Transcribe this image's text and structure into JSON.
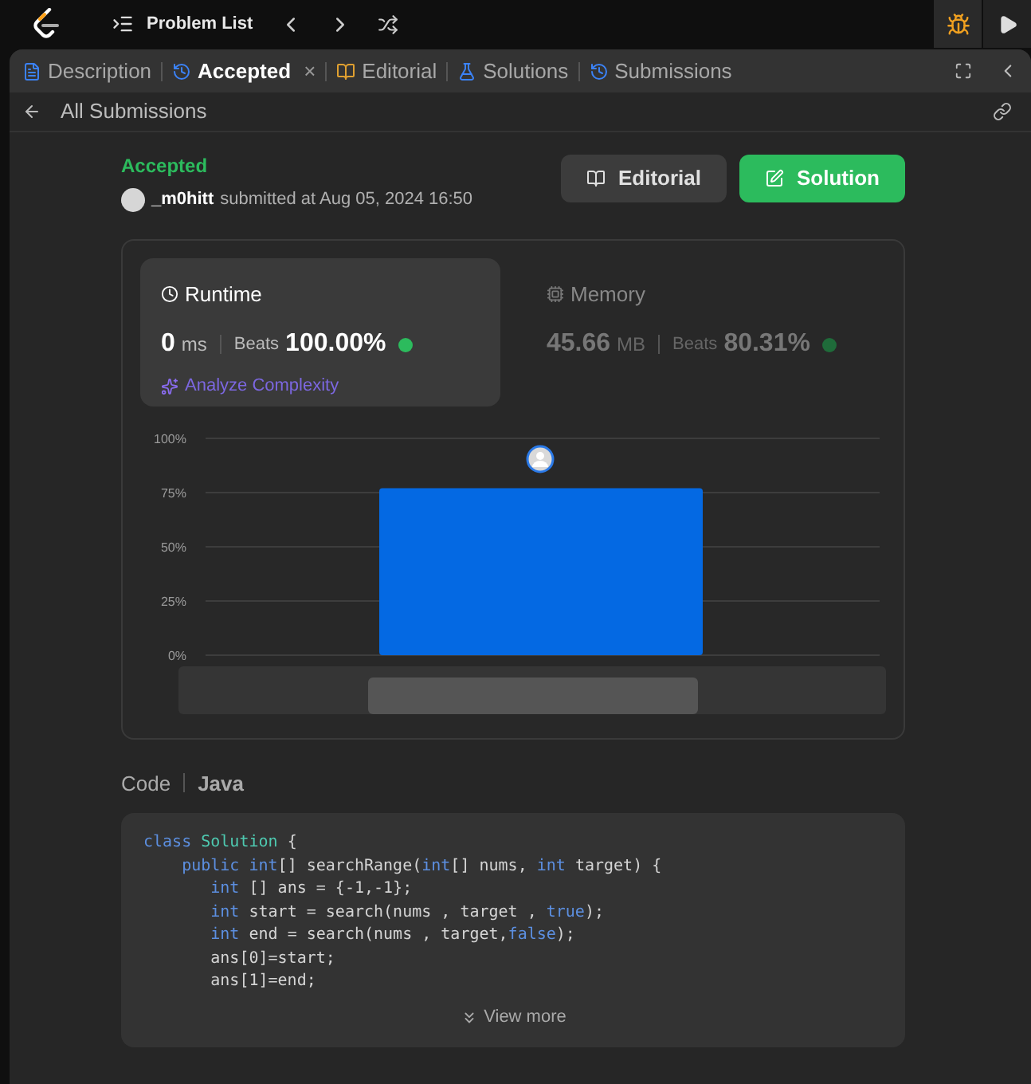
{
  "topbar": {
    "title": "Problem List"
  },
  "tabs": [
    {
      "label": "Description",
      "kind": "description",
      "selected": false,
      "closable": false
    },
    {
      "label": "Accepted",
      "kind": "accepted",
      "selected": true,
      "closable": true
    },
    {
      "label": "Editorial",
      "kind": "editorial",
      "selected": false,
      "closable": false
    },
    {
      "label": "Solutions",
      "kind": "solutions",
      "selected": false,
      "closable": false
    },
    {
      "label": "Submissions",
      "kind": "submissions",
      "selected": false,
      "closable": false
    }
  ],
  "close_glyph": "×",
  "back_link": "All Submissions",
  "submission": {
    "status": "Accepted",
    "user": "_m0hitt",
    "submitted": "submitted at Aug 05, 2024 16:50"
  },
  "buttons": [
    {
      "label": "Editorial",
      "kind": "editorial"
    },
    {
      "label": "Solution",
      "kind": "solution"
    }
  ],
  "metrics": [
    {
      "title": "Runtime",
      "kind": "runtime",
      "selected": true,
      "value": "0",
      "unit": "ms",
      "beats_label": "Beats",
      "beats": "100.00%",
      "link": "Analyze Complexity"
    },
    {
      "title": "Memory",
      "kind": "memory",
      "selected": false,
      "value": "45.66",
      "unit": "MB",
      "beats_label": "Beats",
      "beats": "80.31%"
    }
  ],
  "chart_data": {
    "type": "bar",
    "grid": true,
    "values": [
      77
    ],
    "ylim": [
      0,
      100
    ],
    "yticks": [
      {
        "value": 0,
        "label": "0%"
      },
      {
        "value": 25,
        "label": "25%"
      },
      {
        "value": 50,
        "label": "50%"
      },
      {
        "value": 75,
        "label": "75%"
      },
      {
        "value": 100,
        "label": "100%"
      }
    ]
  },
  "code": {
    "heading": "Code",
    "language": "Java",
    "view_more": "View more",
    "lines": [
      [
        {
          "kind": "keyword",
          "text": "class "
        },
        {
          "kind": "type",
          "text": "Solution"
        },
        {
          "kind": "plain",
          "text": " {"
        }
      ],
      [
        {
          "kind": "keyword",
          "text": "    public "
        },
        {
          "kind": "keyword",
          "text": "int"
        },
        {
          "kind": "plain",
          "text": "[] searchRange("
        },
        {
          "kind": "keyword",
          "text": "int"
        },
        {
          "kind": "plain",
          "text": "[] nums, "
        },
        {
          "kind": "keyword",
          "text": "int"
        },
        {
          "kind": "plain",
          "text": " target) {"
        }
      ],
      [
        {
          "kind": "keyword",
          "text": "       int"
        },
        {
          "kind": "plain",
          "text": " [] ans = {-1,-1};"
        }
      ],
      [
        {
          "kind": "keyword",
          "text": "       int"
        },
        {
          "kind": "plain",
          "text": " start = search(nums , target , "
        },
        {
          "kind": "keyword",
          "text": "true"
        },
        {
          "kind": "plain",
          "text": ");"
        }
      ],
      [
        {
          "kind": "keyword",
          "text": "       int"
        },
        {
          "kind": "plain",
          "text": " end = search(nums , target,"
        },
        {
          "kind": "keyword",
          "text": "false"
        },
        {
          "kind": "plain",
          "text": ");"
        }
      ],
      [
        {
          "kind": "plain",
          "text": "       ans[0]=start;"
        }
      ],
      [
        {
          "kind": "plain",
          "text": "       ans[1]=end;"
        }
      ]
    ]
  }
}
